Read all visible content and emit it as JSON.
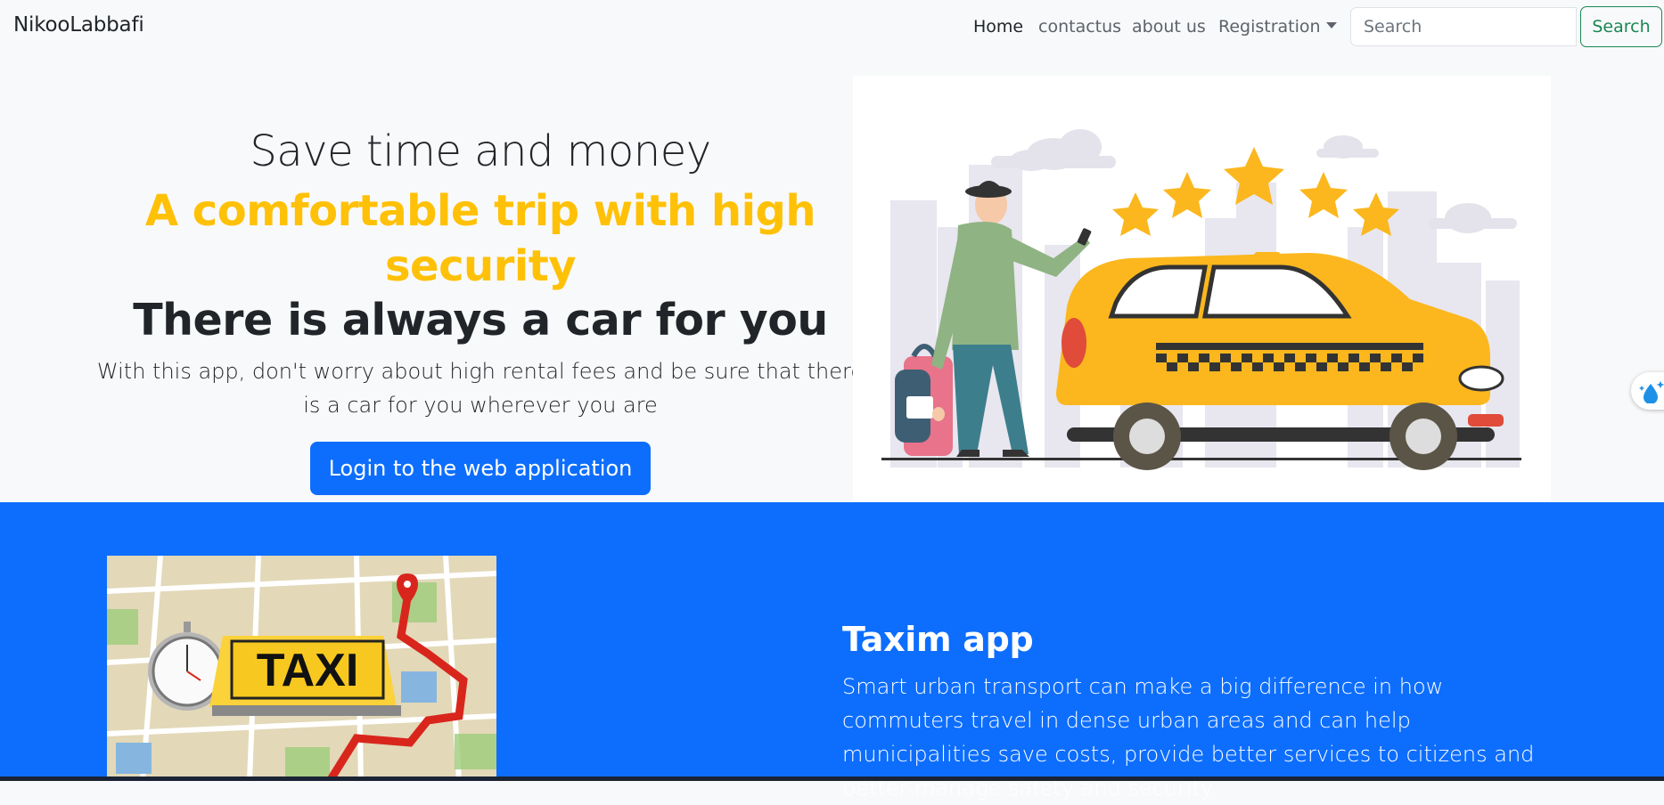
{
  "navbar": {
    "brand": "NikooLabbafi",
    "links": [
      "Home",
      "contactus",
      "about us",
      "Registration"
    ],
    "search": {
      "placeholder": "Search",
      "button_label": "Search"
    }
  },
  "hero": {
    "subtitle": "Save time and money",
    "tagline": "A comfortable trip with high security",
    "title": "There is always a car for you",
    "text": "With this app, don't worry about high rental fees and be sure that there is a car for you wherever you are",
    "button_label": "Login to the web application",
    "image": {
      "sign_text": ""
    }
  },
  "feature": {
    "image_sign": "TAXI",
    "title": "Taxim app",
    "text": "Smart urban transport can make a big difference in how commuters travel in dense urban areas and can help municipalities save costs, provide better services to citizens and better manage safety and security."
  },
  "colors": {
    "primary": "#0d6efd",
    "accent_yellow": "#ffc107",
    "success": "#198754",
    "taxi_yellow": "#fbb71d"
  }
}
